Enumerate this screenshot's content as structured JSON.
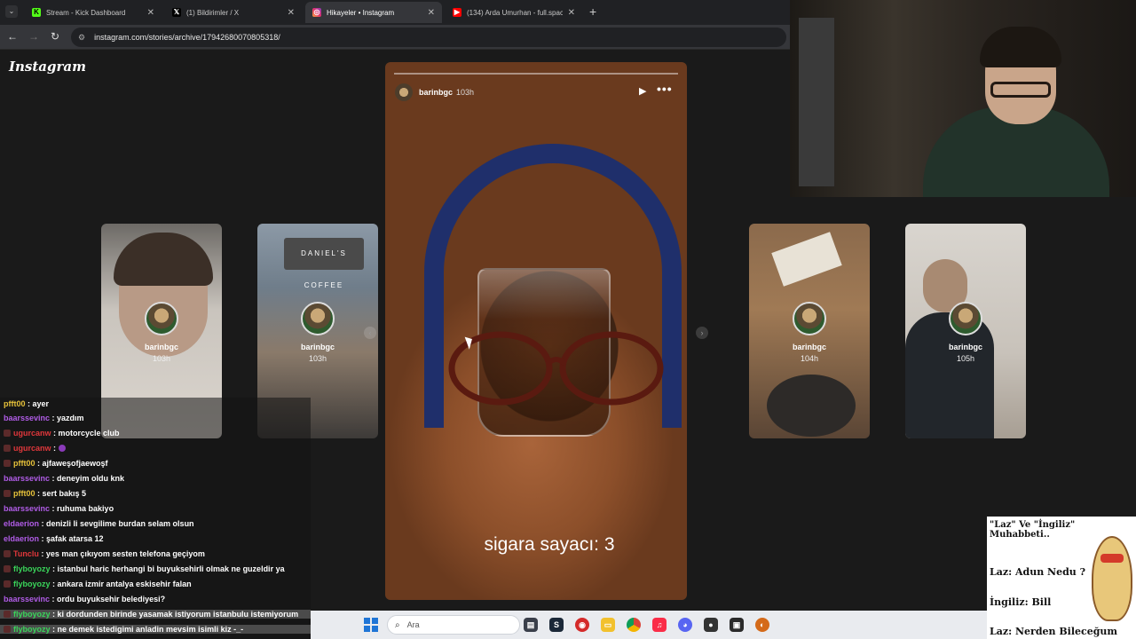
{
  "browser": {
    "tabs": [
      {
        "title": "Stream - Kick Dashboard",
        "icon": "kick-icon",
        "color": "#53fc18"
      },
      {
        "title": "(1) Bildirimler / X",
        "icon": "x-icon",
        "color": "#000000"
      },
      {
        "title": "Hikayeler • Instagram",
        "icon": "instagram-icon",
        "color": "#e1306c"
      },
      {
        "title": "(134) Arda Umurhan - full.spac",
        "icon": "youtube-icon",
        "color": "#ff0000"
      }
    ],
    "url": "instagram.com/stories/archive/17942680070805318/"
  },
  "instagram": {
    "logo": "Instagram",
    "side_stories": [
      {
        "user": "barinbgc",
        "time": "103h"
      },
      {
        "user": "barinbgc",
        "time": "103h"
      },
      {
        "user": "barinbgc",
        "time": "104h"
      },
      {
        "user": "barinbgc",
        "time": "105h"
      }
    ],
    "side_story_text": "DANIEL'S COFFEE",
    "current_story": {
      "user": "barinbgc",
      "time": "103h",
      "caption": "sigara sayacı: 3"
    }
  },
  "chat": {
    "messages": [
      {
        "user": "pfft00",
        "text": "ayer",
        "color": "#e6c13a"
      },
      {
        "user": "baarssevinc",
        "text": "yazdım",
        "color": "#b05ce6"
      },
      {
        "user": "ugurcanw",
        "text": "motorcycle club",
        "color": "#e0373b",
        "badge": true
      },
      {
        "user": "ugurcanw",
        "text": "",
        "color": "#e0373b",
        "badge": true
      },
      {
        "user": "pfft00",
        "text": "ajfaweşofjaewoşf",
        "color": "#e6c13a"
      },
      {
        "user": "baarssevinc",
        "text": "deneyim oldu knk",
        "color": "#b05ce6"
      },
      {
        "user": "pfft00",
        "text": "sert bakış 5",
        "color": "#e6c13a"
      },
      {
        "user": "baarssevinc",
        "text": "ruhuma bakiyo",
        "color": "#b05ce6"
      },
      {
        "user": "eldaerion",
        "text": "denizli li sevgilime burdan selam olsun",
        "color": "#b05ce6"
      },
      {
        "user": "eldaerion",
        "text": "şafak atarsa 12",
        "color": "#b05ce6"
      },
      {
        "user": "Tunclu",
        "text": "yes man çıkıyom sesten telefona geçiyom",
        "color": "#e0373b",
        "badge": true
      },
      {
        "user": "flyboyozy",
        "text": "istanbul haric herhangi bi buyuksehirli olmak ne guzeldir ya",
        "color": "#3ad45a",
        "badge": true
      },
      {
        "user": "flyboyozy",
        "text": "ankara izmir antalya eskisehir falan",
        "color": "#3ad45a",
        "badge": true
      },
      {
        "user": "baarssevinc",
        "text": "ordu buyuksehir belediyesi?",
        "color": "#b05ce6"
      },
      {
        "user": "flyboyozy",
        "text": "ki dordunden birinde yasamak istiyorum istanbulu istemiyorum",
        "color": "#3ad45a",
        "badge": true,
        "highlight": true
      },
      {
        "user": "flyboyozy",
        "text": "ne demek istedigimi anladin mevsim isimli kiz -_-",
        "color": "#3ad45a",
        "badge": true,
        "highlight": true
      }
    ]
  },
  "meme": {
    "title": "\"Laz\" Ve \"İngiliz\" Muhabbeti..",
    "lines": [
      "Laz: Adun Nedu ?",
      "İngiliz: Bill",
      "Laz: Nerden Bileceğum"
    ]
  },
  "taskbar": {
    "search_placeholder": "Ara"
  }
}
